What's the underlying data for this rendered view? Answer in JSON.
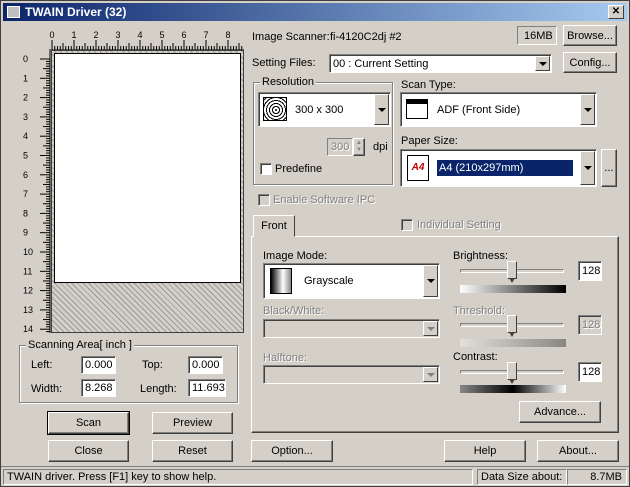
{
  "window": {
    "title": "TWAIN Driver (32)",
    "close_symbol": "✕"
  },
  "ruler": {
    "h_ticks": [
      "0",
      "1",
      "2",
      "3",
      "4",
      "5",
      "6",
      "7",
      "8"
    ],
    "v_ticks": [
      "0",
      "1",
      "2",
      "3",
      "4",
      "5",
      "6",
      "7",
      "8",
      "9",
      "10",
      "11",
      "12",
      "13",
      "14"
    ]
  },
  "scanning_area": {
    "title": "Scanning Area[ inch ]",
    "left_label": "Left:",
    "left_value": "0.000",
    "top_label": "Top:",
    "top_value": "0.000",
    "width_label": "Width:",
    "width_value": "8.268",
    "length_label": "Length:",
    "length_value": "11.693"
  },
  "left_buttons": {
    "scan": "Scan",
    "preview": "Preview",
    "close": "Close",
    "reset": "Reset"
  },
  "scanner": {
    "label": "Image Scanner:",
    "name": "fi-4120C2dj #2",
    "memory": "16MB",
    "browse": "Browse..."
  },
  "setting_files": {
    "label": "Setting Files:",
    "value": "00 : Current Setting",
    "config": "Config..."
  },
  "resolution": {
    "title": "Resolution",
    "value": "300 x 300",
    "spin_value": "300",
    "unit": "dpi",
    "predefine": "Predefine"
  },
  "scan_type": {
    "label": "Scan Type:",
    "value": "ADF (Front Side)"
  },
  "paper_size": {
    "label": "Paper Size:",
    "value": "A4 (210x297mm)",
    "icon_text": "A4",
    "more": "..."
  },
  "software_ipc": {
    "label": "Enable Software IPC"
  },
  "tabs": {
    "front": "Front",
    "individual": "Individual Setting"
  },
  "image_mode": {
    "label": "Image Mode:",
    "value": "Grayscale",
    "bw_label": "Black/White:",
    "halftone_label": "Halftone:"
  },
  "brightness": {
    "label": "Brightness:",
    "value": "128",
    "level": 0.5
  },
  "threshold": {
    "label": "Threshold:",
    "value": "128",
    "level": 0.5
  },
  "contrast": {
    "label": "Contrast:",
    "value": "128",
    "level": 0.5
  },
  "advance": "Advance...",
  "bottom_buttons": {
    "option": "Option...",
    "help": "Help",
    "about": "About..."
  },
  "status": {
    "message": "TWAIN driver. Press [F1] key to show help.",
    "data_size_label": "Data Size about:",
    "data_size_value": "8.7MB"
  }
}
